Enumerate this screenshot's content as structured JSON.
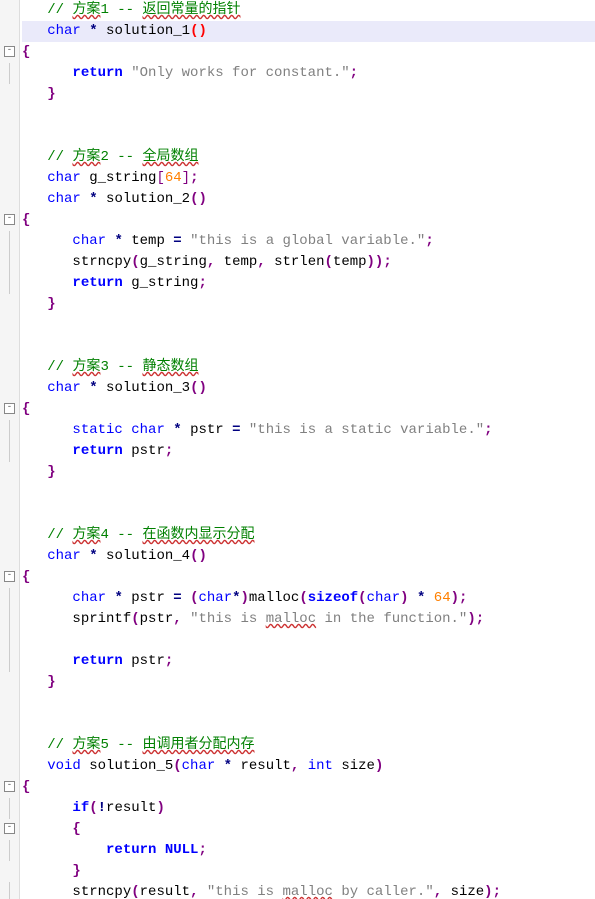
{
  "chart_data": null,
  "code": {
    "lines": [
      {
        "gutter": "",
        "kind": "comment",
        "text_parts": [
          "// ",
          "方案",
          "1 -- ",
          "返回常量的指针"
        ]
      },
      {
        "gutter": "",
        "kind": "sig_hl",
        "ret": "char",
        "star": "*",
        "name": "solution_1",
        "open": "(",
        "close": ")",
        "match": true
      },
      {
        "gutter": "box",
        "kind": "brace_open"
      },
      {
        "gutter": "line",
        "kind": "return_str",
        "ret": "return",
        "str": "\"Only works for constant.\"",
        "semi": ";"
      },
      {
        "gutter": "",
        "kind": "brace_close"
      },
      {
        "gutter": "",
        "kind": "blank"
      },
      {
        "gutter": "",
        "kind": "blank"
      },
      {
        "gutter": "",
        "kind": "comment",
        "text_parts": [
          "// ",
          "方案",
          "2 -- ",
          "全局数组"
        ]
      },
      {
        "gutter": "",
        "kind": "decl_array",
        "type": "char",
        "name": "g_string",
        "open": "[",
        "num": "64",
        "close": "]",
        "semi": ";"
      },
      {
        "gutter": "",
        "kind": "sig",
        "ret": "char",
        "star": "*",
        "name": "solution_2",
        "open": "(",
        "close": ")"
      },
      {
        "gutter": "box",
        "kind": "brace_open"
      },
      {
        "gutter": "line",
        "kind": "decl_init_str",
        "type": "char",
        "star": "*",
        "name": "temp",
        "eq": "=",
        "str": "\"this is a global variable.\"",
        "semi": ";"
      },
      {
        "gutter": "line",
        "kind": "strncpy3",
        "fn": "strncpy",
        "a1": "g_string",
        "a2": "temp",
        "fn2": "strlen",
        "a3": "temp",
        "semi": ";"
      },
      {
        "gutter": "line",
        "kind": "return_id",
        "ret": "return",
        "id": "g_string",
        "semi": ";"
      },
      {
        "gutter": "",
        "kind": "brace_close"
      },
      {
        "gutter": "",
        "kind": "blank"
      },
      {
        "gutter": "",
        "kind": "blank"
      },
      {
        "gutter": "",
        "kind": "comment",
        "text_parts": [
          "// ",
          "方案",
          "3 -- ",
          "静态数组"
        ]
      },
      {
        "gutter": "",
        "kind": "sig",
        "ret": "char",
        "star": "*",
        "name": "solution_3",
        "open": "(",
        "close": ")"
      },
      {
        "gutter": "box",
        "kind": "brace_open"
      },
      {
        "gutter": "line",
        "kind": "static_str",
        "stat": "static",
        "type": "char",
        "star": "*",
        "name": "pstr",
        "eq": "=",
        "str": "\"this is a static variable.\"",
        "semi": ";"
      },
      {
        "gutter": "line",
        "kind": "return_id",
        "ret": "return",
        "id": "pstr",
        "semi": ";"
      },
      {
        "gutter": "",
        "kind": "brace_close"
      },
      {
        "gutter": "",
        "kind": "blank"
      },
      {
        "gutter": "",
        "kind": "blank"
      },
      {
        "gutter": "",
        "kind": "comment",
        "text_parts": [
          "// ",
          "方案",
          "4 -- ",
          "在函数内显示分配"
        ]
      },
      {
        "gutter": "",
        "kind": "sig",
        "ret": "char",
        "star": "*",
        "name": "solution_4",
        "open": "(",
        "close": ")"
      },
      {
        "gutter": "box",
        "kind": "brace_open"
      },
      {
        "gutter": "line",
        "kind": "malloc_line",
        "type": "char",
        "star": "*",
        "name": "pstr",
        "eq": "=",
        "cast_open": "(",
        "cast_type": "char",
        "cast_star": "*",
        "cast_close": ")",
        "fn": "malloc",
        "open": "(",
        "sz": "sizeof",
        "szopen": "(",
        "sztype": "char",
        "szclose": ")",
        "mul": "*",
        "num": "64",
        "close": ")",
        "semi": ";"
      },
      {
        "gutter": "line",
        "kind": "sprintf_line",
        "fn": "sprintf",
        "open": "(",
        "a1": "pstr",
        "str": "\"this is malloc in the function.\"",
        "close": ")",
        "semi": ";"
      },
      {
        "gutter": "line",
        "kind": "blank"
      },
      {
        "gutter": "line",
        "kind": "return_id",
        "ret": "return",
        "id": "pstr",
        "semi": ";"
      },
      {
        "gutter": "",
        "kind": "brace_close"
      },
      {
        "gutter": "",
        "kind": "blank"
      },
      {
        "gutter": "",
        "kind": "blank"
      },
      {
        "gutter": "",
        "kind": "comment",
        "text_parts": [
          "// ",
          "方案",
          "5 -- ",
          "由调用者分配内存"
        ]
      },
      {
        "gutter": "",
        "kind": "void_sig",
        "ret": "void",
        "name": "solution_5",
        "open": "(",
        "p1t": "char",
        "p1s": "*",
        "p1n": "result",
        "comma": ",",
        "p2t": "int",
        "p2n": "size",
        "close": ")"
      },
      {
        "gutter": "box",
        "kind": "brace_open"
      },
      {
        "gutter": "line",
        "kind": "if_line",
        "kw": "if",
        "open": "(",
        "bang": "!",
        "id": "result",
        "close": ")"
      },
      {
        "gutter": "box",
        "kind": "brace_open_indent"
      },
      {
        "gutter": "line",
        "kind": "return_null",
        "ret": "return",
        "null": "NULL",
        "semi": ";"
      },
      {
        "gutter": "",
        "kind": "brace_close_indent"
      },
      {
        "gutter": "line",
        "kind": "strncpy_sz",
        "fn": "strncpy",
        "open": "(",
        "a1": "result",
        "str": "\"this is malloc by caller.\"",
        "a3": "size",
        "close": ")",
        "semi": ";"
      }
    ]
  }
}
